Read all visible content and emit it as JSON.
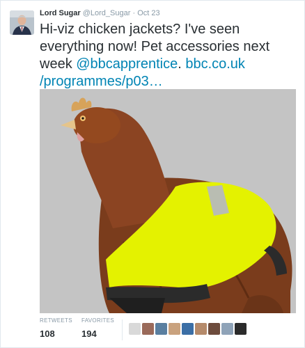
{
  "tweet": {
    "author_name": "Lord Sugar",
    "handle": "@Lord_Sugar",
    "separator": "·",
    "date": "Oct 23",
    "text_part1": "Hi-viz chicken jackets? I've seen everything now! Pet accessories next week ",
    "mention": "@bbcapprentice",
    "text_part2": ". ",
    "link": "bbc.co.uk /programmes/p03…"
  },
  "stats": {
    "retweets_label": "RETWEETS",
    "retweets_count": "108",
    "favorites_label": "FAVORITES",
    "favorites_count": "194"
  },
  "favoriter_avatars": [
    {
      "name": "avatar-1",
      "color": "#d9d9d9"
    },
    {
      "name": "avatar-2",
      "color": "#9a6a5a"
    },
    {
      "name": "avatar-3",
      "color": "#5a7fa0"
    },
    {
      "name": "avatar-4",
      "color": "#c9a27e"
    },
    {
      "name": "avatar-5",
      "color": "#3b6ea5"
    },
    {
      "name": "avatar-6",
      "color": "#b58a6a"
    },
    {
      "name": "avatar-7",
      "color": "#6d4c3d"
    },
    {
      "name": "avatar-8",
      "color": "#8fa3b8"
    },
    {
      "name": "avatar-9",
      "color": "#2b2b2b"
    }
  ],
  "colors": {
    "link": "#0084b4",
    "text": "#292f33",
    "muted": "#8899a6",
    "media_background": "#c4c4c4",
    "hiviz_yellow": "#e4f200"
  }
}
